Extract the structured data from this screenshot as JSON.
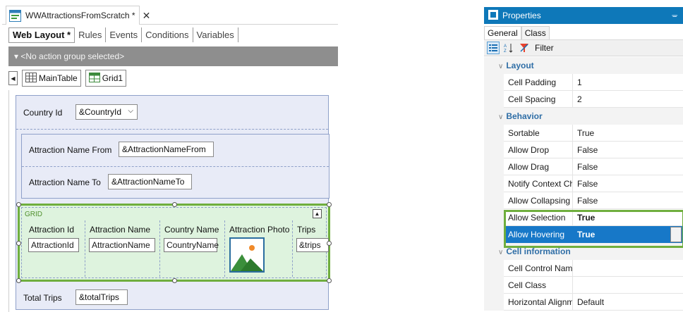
{
  "designer": {
    "doc_tab_title": "WWAttractionsFromScratch *",
    "close_glyph": "✕",
    "subtabs": [
      "Web Layout *",
      "Rules",
      "Events",
      "Conditions",
      "Variables"
    ],
    "action_group": "▾ <No action group selected>",
    "breadcrumb": {
      "back_glyph": "◀",
      "items": [
        "MainTable",
        "Grid1"
      ]
    },
    "form": {
      "country_label": "Country Id",
      "country_field": "&CountryId",
      "attraction_from_label": "Attraction Name From",
      "attraction_from_field": "&AttractionNameFrom",
      "attraction_to_label": "Attraction Name To",
      "attraction_to_field": "&AttractionNameTo",
      "total_label": "Total Trips",
      "total_field": "&totalTrips"
    },
    "grid": {
      "label": "GRID",
      "columns": [
        {
          "header": "Attraction Id",
          "field": "AttractionId"
        },
        {
          "header": "Attraction Name",
          "field": "AttractionName"
        },
        {
          "header": "Country Name",
          "field": "CountryName"
        },
        {
          "header": "Attraction Photo",
          "field": ""
        },
        {
          "header": "Trips",
          "field": "&trips"
        }
      ]
    }
  },
  "properties": {
    "title": "Properties",
    "pin_glyph": "ᚚ",
    "tabs": [
      "General",
      "Class"
    ],
    "filter_label": "Filter",
    "categories": {
      "layout": "Layout",
      "behavior": "Behavior",
      "cell_information": "Cell information"
    },
    "rows": [
      {
        "name": "Cell Padding",
        "value": "1"
      },
      {
        "name": "Cell Spacing",
        "value": "2"
      },
      {
        "name": "Sortable",
        "value": "True"
      },
      {
        "name": "Allow Drop",
        "value": "False"
      },
      {
        "name": "Allow Drag",
        "value": "False"
      },
      {
        "name": "Notify Context Cha",
        "value": "False"
      },
      {
        "name": "Allow Collapsing",
        "value": "False"
      },
      {
        "name": "Allow Selection",
        "value": "True"
      },
      {
        "name": "Allow Hovering",
        "value": "True"
      },
      {
        "name": "Cell Control Name",
        "value": ""
      },
      {
        "name": "Cell Class",
        "value": ""
      },
      {
        "name": "Horizontal Alignm",
        "value": "Default"
      }
    ]
  },
  "colors": {
    "accent_blue": "#0e78b9",
    "selection_blue": "#1778c8",
    "highlight_green": "#6fae3e",
    "grid_fill": "#def3de",
    "table_fill": "#e8ebf7"
  }
}
